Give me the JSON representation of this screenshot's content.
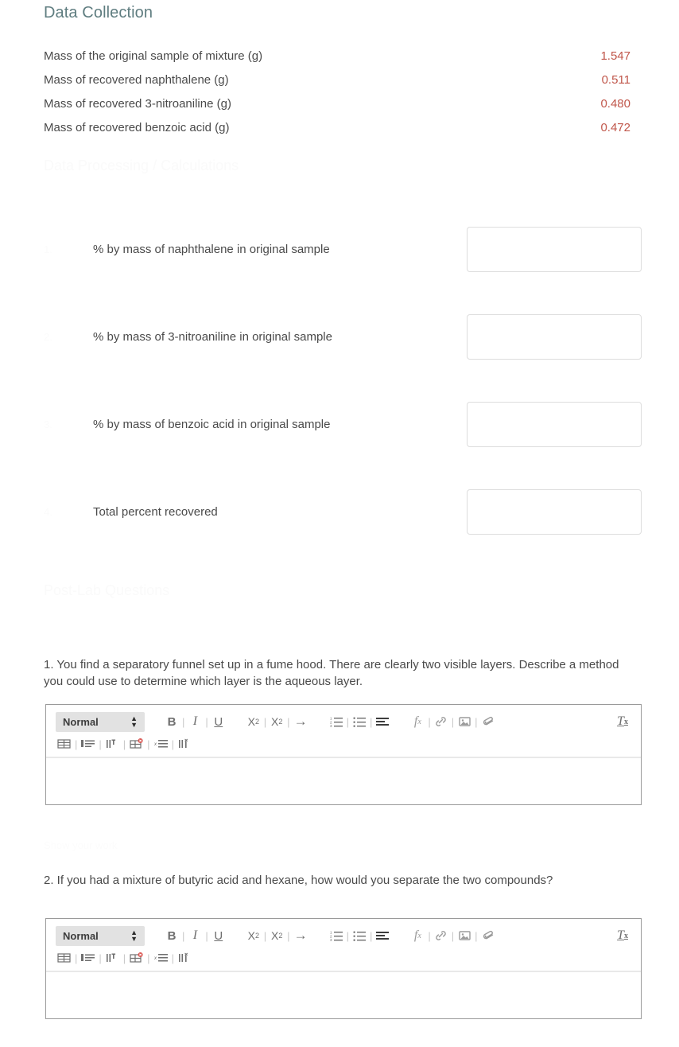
{
  "section": {
    "title": "Data Collection"
  },
  "data_table": {
    "rows": [
      {
        "label": "Mass of the original sample of mixture (g)",
        "value": "1.547"
      },
      {
        "label": "Mass of recovered naphthalene (g)",
        "value": "0.511"
      },
      {
        "label": "Mass of recovered 3-nitroaniline (g)",
        "value": "0.480"
      },
      {
        "label": "Mass of recovered benzoic acid (g)",
        "value": "0.472"
      }
    ]
  },
  "faint": {
    "calculations_heading": "Data Processing / Calculations",
    "questions_heading": "Post-Lab Questions",
    "note_between": "Show your work"
  },
  "calculations": {
    "rows": [
      {
        "number": "1.",
        "label": "% by mass of naphthalene in original sample",
        "value": "",
        "placeholder": ""
      },
      {
        "number": "2.",
        "label": "% by mass of 3-nitroaniline in original sample",
        "value": "",
        "placeholder": ""
      },
      {
        "number": "3.",
        "label": "% by mass of benzoic acid in original sample",
        "value": "",
        "placeholder": ""
      },
      {
        "number": "4.",
        "label": "Total percent recovered",
        "value": "",
        "placeholder": ""
      }
    ]
  },
  "questions": [
    {
      "text": "1. You find a separatory funnel set up in a fume hood. There are clearly two visible layers. Describe a method you could use to determine which layer is the aqueous layer.",
      "answer": ""
    },
    {
      "text": "2. If you had a mixture of butyric acid and hexane, how would you separate the two compounds?",
      "answer": ""
    }
  ],
  "editor_toolbar": {
    "style_label": "Normal",
    "bold_label": "B",
    "italic_label": "I",
    "underline_label": "U",
    "separator": "|",
    "subscript_label": "X",
    "subscript_index": "2",
    "superscript_label": "X",
    "superscript_index": "2",
    "arrow_label": "→",
    "formula_label": "f",
    "formula_index": "x",
    "clear_format_label": "T",
    "clear_format_index": "x"
  },
  "colors": {
    "title": "#5f7d80",
    "value_red": "#c0564a",
    "body_text": "#4a4a4a",
    "input_border": "#dddddd",
    "editor_border": "#9a9a9a",
    "toolbar_icon": "#6e6e6e",
    "select_bg": "#e2e2e2",
    "badge_red": "#d9534f"
  }
}
